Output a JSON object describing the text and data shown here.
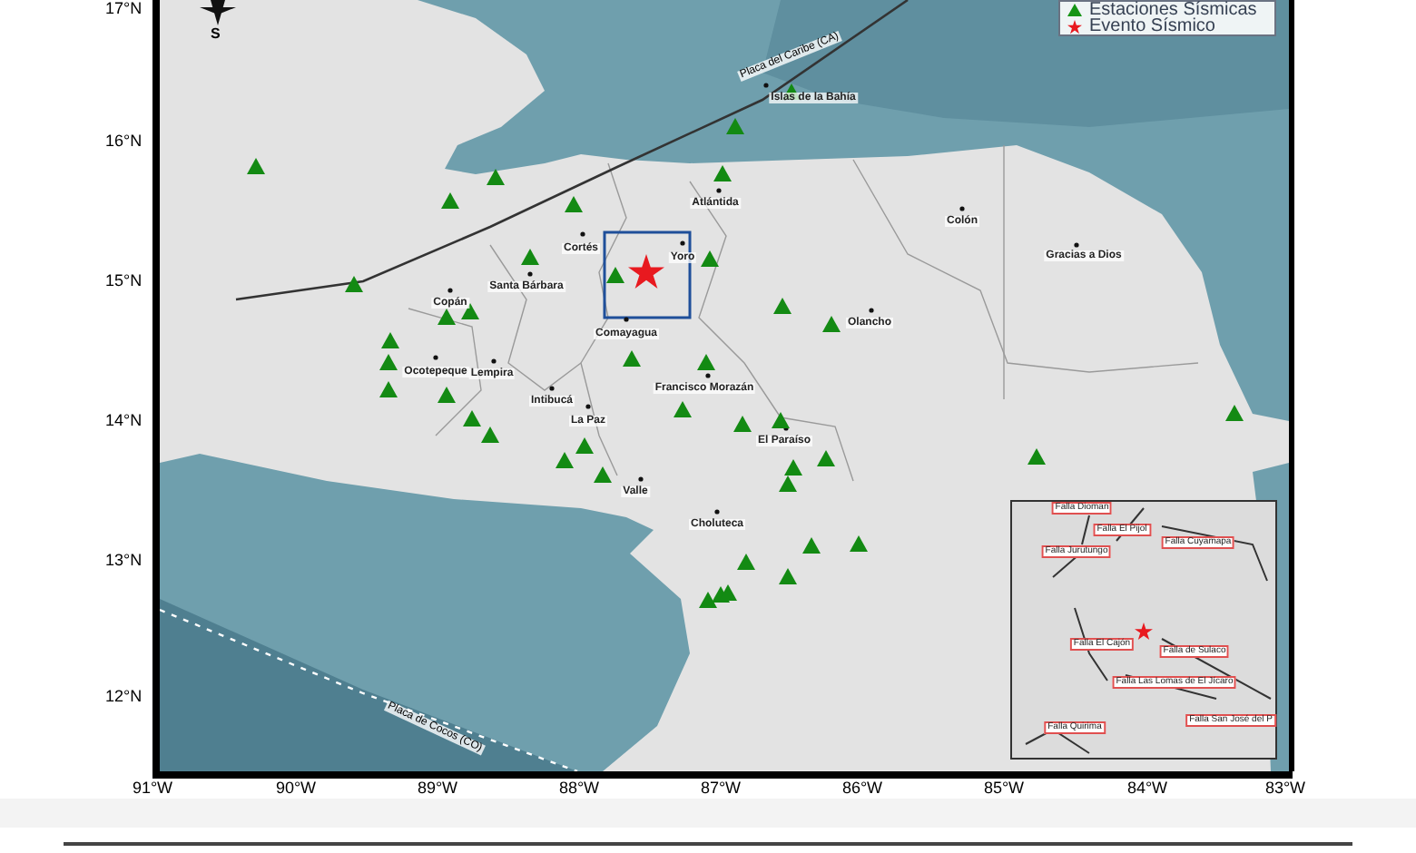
{
  "legend": [
    {
      "kind": "station",
      "label": "Estaciones Sísmicas"
    },
    {
      "kind": "event",
      "label": "Evento Sísmico"
    }
  ],
  "compass": {
    "label": "S"
  },
  "plates": [
    "Placa del Caribe (CA)",
    "Placa de Cocos (CO)"
  ],
  "places": [
    "Islas de la Bahía",
    "Atlántida",
    "Cortés",
    "Yoro",
    "Colón",
    "Gracias a Dios",
    "Santa Bárbara",
    "Copán",
    "Comayagua",
    "Olancho",
    "Ocotepeque",
    "Lempira",
    "Intibucá",
    "Francisco Morazán",
    "La Paz",
    "El Paraíso",
    "Valle",
    "Choluteca"
  ],
  "inset": {
    "faults": [
      "Falla Dioman",
      "Falla El Pijol",
      "Falla Cuyamapa",
      "Falla Jurutungo",
      "Falla El Cajón",
      "Falla de Sulaco",
      "Falla Las Lomas de El Jícaro",
      "Falla San José del P",
      "Falla Quirima"
    ]
  },
  "x_ticks": [
    "91°W",
    "90°W",
    "89°W",
    "88°W",
    "87°W",
    "86°W",
    "85°W",
    "84°W",
    "83°W"
  ],
  "y_ticks": [
    "17°N",
    "16°N",
    "15°N",
    "14°N",
    "13°N",
    "12°N"
  ]
}
